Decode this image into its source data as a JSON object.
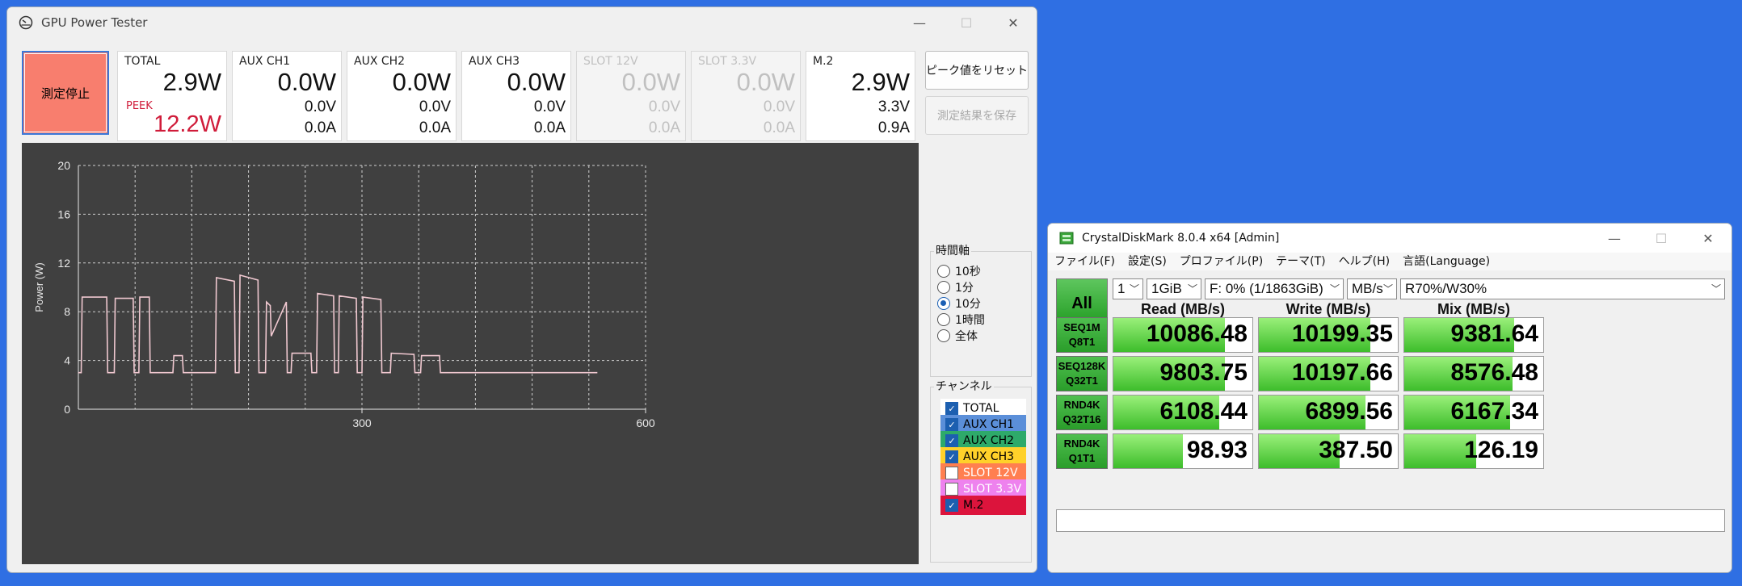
{
  "gpu_tester": {
    "title": "GPU Power Tester",
    "window_controls": {
      "minimize": "—",
      "maximize": "☐",
      "close": "✕"
    },
    "stop_button": "測定停止",
    "meters": [
      {
        "name": "TOTAL",
        "watts": "2.9W",
        "peek_label": "PEEK",
        "peek": "12.2W",
        "enabled": true
      },
      {
        "name": "AUX CH1",
        "watts": "0.0W",
        "volts": "0.0V",
        "amps": "0.0A",
        "enabled": true
      },
      {
        "name": "AUX CH2",
        "watts": "0.0W",
        "volts": "0.0V",
        "amps": "0.0A",
        "enabled": true
      },
      {
        "name": "AUX CH3",
        "watts": "0.0W",
        "volts": "0.0V",
        "amps": "0.0A",
        "enabled": true
      },
      {
        "name": "SLOT 12V",
        "watts": "0.0W",
        "volts": "0.0V",
        "amps": "0.0A",
        "enabled": false
      },
      {
        "name": "SLOT 3.3V",
        "watts": "0.0W",
        "volts": "0.0V",
        "amps": "0.0A",
        "enabled": false
      },
      {
        "name": "M.2",
        "watts": "2.9W",
        "volts": "3.3V",
        "amps": "0.9A",
        "enabled": true
      }
    ],
    "reset_peak_button": "ピーク値をリセット",
    "save_results_button": "測定結果を保存",
    "time_axis": {
      "title": "時間軸",
      "options": [
        "10秒",
        "1分",
        "10分",
        "1時間",
        "全体"
      ],
      "selected": "10分"
    },
    "channels": {
      "title": "チャンネル",
      "items": [
        {
          "label": "TOTAL",
          "checked": true,
          "bg": "#ffffff",
          "color": "#000000"
        },
        {
          "label": "AUX CH1",
          "checked": true,
          "bg": "#5b8fd9",
          "color": "#000000"
        },
        {
          "label": "AUX CH2",
          "checked": true,
          "bg": "#2eaa6a",
          "color": "#000000"
        },
        {
          "label": "AUX CH3",
          "checked": true,
          "bg": "#ffd12a",
          "color": "#000000"
        },
        {
          "label": "SLOT 12V",
          "checked": false,
          "bg": "#ff7f50",
          "color": "#ffffff"
        },
        {
          "label": "SLOT 3.3V",
          "checked": false,
          "bg": "#ee82ee",
          "color": "#ffffff"
        },
        {
          "label": "M.2",
          "checked": true,
          "bg": "#dc143c",
          "color": "#000000"
        }
      ]
    },
    "chart_data": {
      "type": "line",
      "title": "",
      "xlabel": "",
      "ylabel": "Power (W)",
      "xlim": [
        0,
        600
      ],
      "ylim": [
        0,
        20
      ],
      "xticks": [
        300,
        600
      ],
      "yticks": [
        0,
        4,
        8,
        12,
        16,
        20
      ],
      "grid": true,
      "series": [
        {
          "color": "#f0c8d0",
          "x": [
            0,
            3,
            4,
            30,
            31,
            38,
            39,
            58,
            59,
            64,
            65,
            75,
            76,
            100,
            101,
            110,
            111,
            145,
            146,
            165,
            166,
            170,
            171,
            190,
            191,
            198,
            199,
            203,
            204,
            220,
            221,
            225,
            226,
            246,
            247,
            252,
            253,
            270,
            271,
            275,
            276,
            294,
            295,
            300,
            301,
            320,
            321,
            330,
            331,
            355,
            356,
            362,
            363,
            382,
            383,
            390,
            391,
            410,
            411,
            420,
            421,
            440,
            441,
            447,
            448,
            458,
            459,
            475,
            476,
            480,
            481,
            490,
            491,
            505,
            506,
            520,
            521,
            535,
            536,
            549
          ],
          "y": [
            3.0,
            3.0,
            9.2,
            9.2,
            3.0,
            3.0,
            9.1,
            9.1,
            3.0,
            3.0,
            9.2,
            9.2,
            3.0,
            3.0,
            4.4,
            4.4,
            3.0,
            3.0,
            10.8,
            10.5,
            3.0,
            3.0,
            11.0,
            10.6,
            3.0,
            3.0,
            8.8,
            8.5,
            6.0,
            8.8,
            3.0,
            3.0,
            4.6,
            4.6,
            3.0,
            3.0,
            9.5,
            9.3,
            3.0,
            3.0,
            9.3,
            9.1,
            3.0,
            3.0,
            9.2,
            9.0,
            3.0,
            3.0,
            4.6,
            4.5,
            3.0,
            3.0,
            4.4,
            4.4,
            3.0,
            3.0,
            3.0,
            3.0,
            3.0,
            3.0,
            3.0,
            3.0,
            3.0,
            3.0,
            3.0,
            3.0,
            3.0,
            3.0,
            3.0,
            3.0,
            3.0,
            3.0,
            3.0,
            3.0,
            3.0,
            3.0,
            3.0,
            3.0,
            3.0,
            3.0
          ]
        }
      ]
    }
  },
  "crystaldiskmark": {
    "title": "CrystalDiskMark 8.0.4 x64 [Admin]",
    "window_controls": {
      "minimize": "—",
      "maximize": "☐",
      "close": "✕"
    },
    "menu": [
      "ファイル(F)",
      "設定(S)",
      "プロファイル(P)",
      "テーマ(T)",
      "ヘルプ(H)",
      "言語(Language)"
    ],
    "all_button": "All",
    "selects": {
      "count": "1",
      "size": "1GiB",
      "drive": "F: 0% (1/1863GiB)",
      "unit": "MB/s",
      "mix": "R70%/W30%"
    },
    "columns": [
      "Read (MB/s)",
      "Write (MB/s)",
      "Mix (MB/s)"
    ],
    "rows": [
      {
        "label1": "SEQ1M",
        "label2": "Q8T1",
        "read": "10086.48",
        "write": "10199.35",
        "mix": "9381.64",
        "fill": [
          0.8,
          0.8,
          0.79
        ]
      },
      {
        "label1": "SEQ128K",
        "label2": "Q32T1",
        "read": "9803.75",
        "write": "10197.66",
        "mix": "8576.48",
        "fill": [
          0.8,
          0.8,
          0.78
        ]
      },
      {
        "label1": "RND4K",
        "label2": "Q32T16",
        "read": "6108.44",
        "write": "6899.56",
        "mix": "6167.34",
        "fill": [
          0.76,
          0.77,
          0.76
        ]
      },
      {
        "label1": "RND4K",
        "label2": "Q1T1",
        "read": "98.93",
        "write": "387.50",
        "mix": "126.19",
        "fill": [
          0.5,
          0.58,
          0.52
        ]
      }
    ],
    "comment": ""
  }
}
